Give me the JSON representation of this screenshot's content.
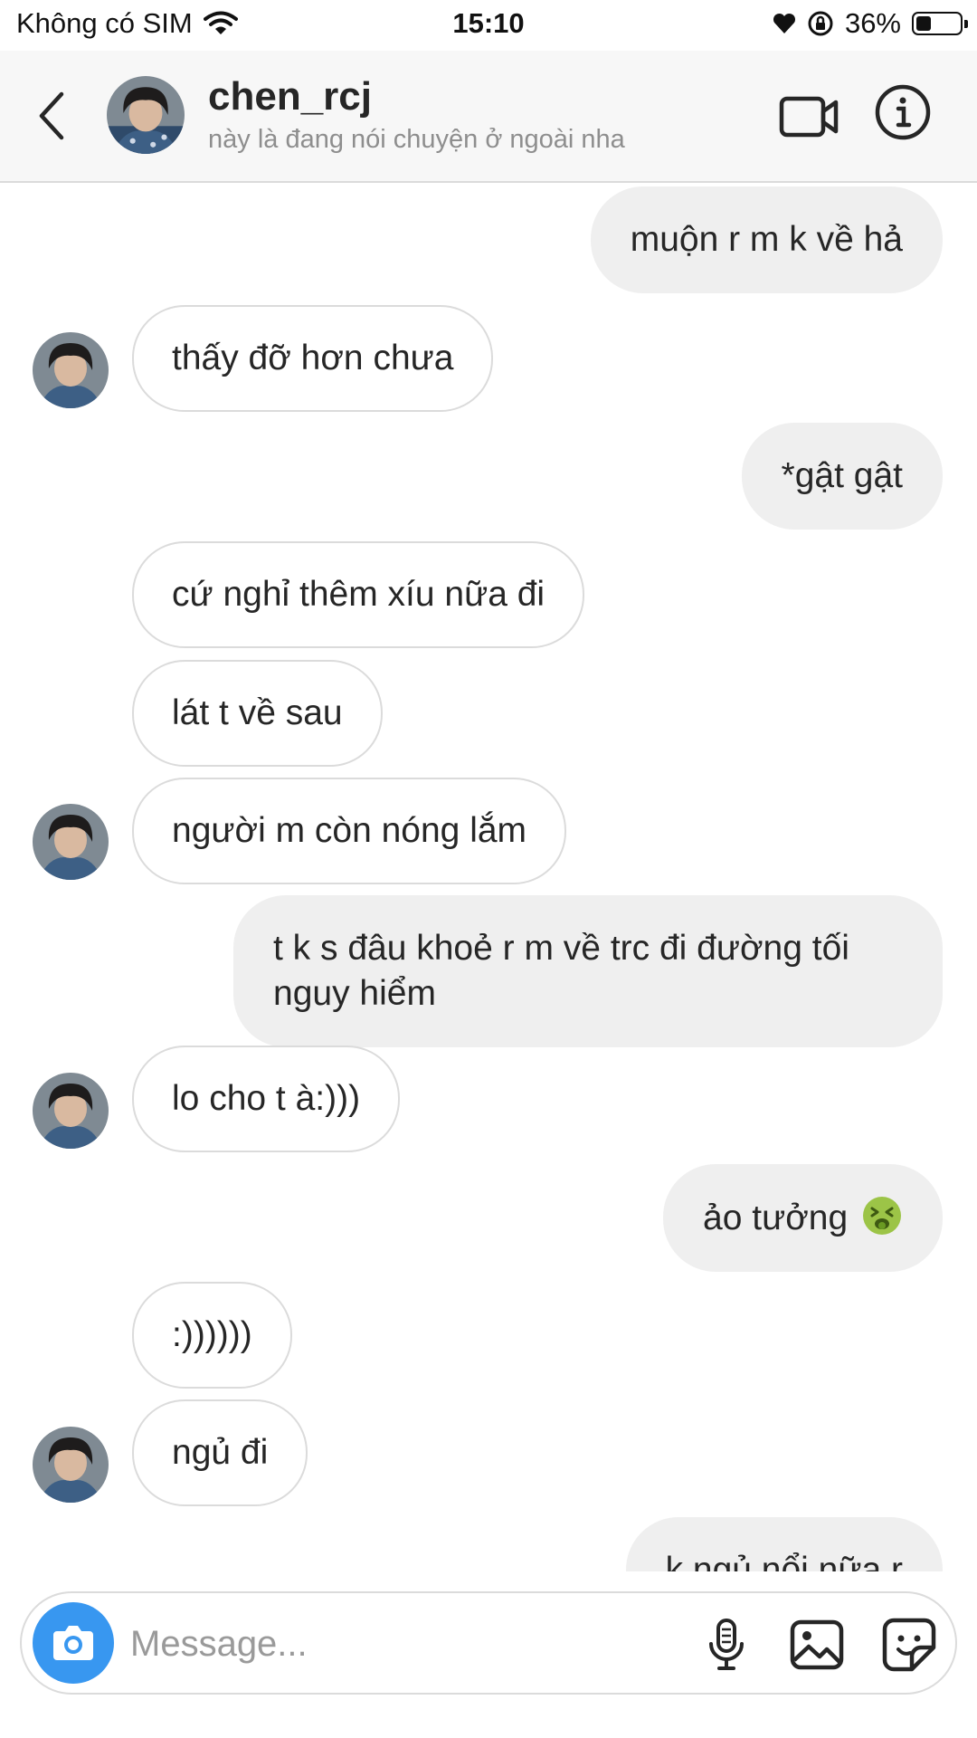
{
  "status_bar": {
    "carrier": "Không có SIM",
    "time": "15:10",
    "battery_percent": "36%",
    "battery_level": 0.36
  },
  "header": {
    "username": "chen_rcj",
    "status": "này là đang nói chuyện ở ngoài nha"
  },
  "messages": [
    {
      "from": "me",
      "text": "muộn r m k về hả"
    },
    {
      "from": "them",
      "text": "thấy đỡ hơn chưa"
    },
    {
      "from": "me",
      "text": "*gật gật"
    },
    {
      "from": "them",
      "text": "cứ nghỉ thêm xíu nữa đi"
    },
    {
      "from": "them",
      "text": "lát t về sau"
    },
    {
      "from": "them",
      "text": "người m còn nóng lắm"
    },
    {
      "from": "me",
      "text": "t k s đâu khoẻ r m về trc đi đường tối nguy hiểm"
    },
    {
      "from": "them",
      "text": "lo cho t à:)))"
    },
    {
      "from": "me",
      "text": "ảo tưởng",
      "emoji": "nauseated-face-emoji"
    },
    {
      "from": "them",
      "text": ":))))))"
    },
    {
      "from": "them",
      "text": "ngủ đi"
    },
    {
      "from": "me",
      "text": "k ngủ nổi nữa r"
    }
  ],
  "composer": {
    "placeholder": "Message..."
  },
  "icons": {
    "back": "chevron-left-icon",
    "video": "video-camera-icon",
    "info": "info-icon",
    "camera": "camera-icon",
    "mic": "microphone-icon",
    "gallery": "image-icon",
    "sticker": "sticker-icon"
  },
  "colors": {
    "accent": "#3897f0",
    "outgoing_bubble": "#efefef",
    "incoming_border": "#dbdbdb",
    "secondary_text": "#8e8e8e"
  }
}
